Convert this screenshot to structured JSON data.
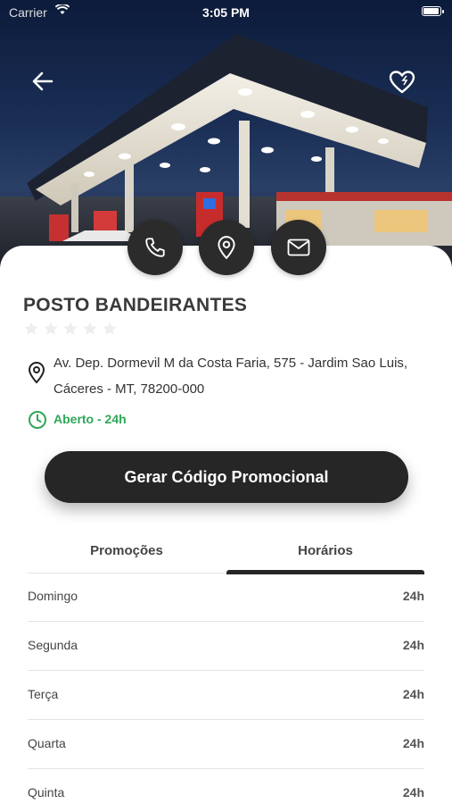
{
  "status_bar": {
    "carrier": "Carrier",
    "time": "3:05 PM",
    "battery_level": 1.0
  },
  "station": {
    "name": "POSTO BANDEIRANTES",
    "rating": 0,
    "rating_max": 5,
    "address": "Av. Dep. Dormevil M da Costa Faria, 575 - Jardim Sao Luis, Cáceres - MT, 78200-000",
    "open_status": "Aberto - 24h"
  },
  "actions": {
    "icons": [
      "phone-icon",
      "map-pin-icon",
      "mail-icon"
    ]
  },
  "promo_button": {
    "label": "Gerar Código Promocional"
  },
  "tabs": [
    {
      "label": "Promoções",
      "active": false
    },
    {
      "label": "Horários",
      "active": true
    }
  ],
  "schedule": [
    {
      "day": "Domingo",
      "hours": "24h"
    },
    {
      "day": "Segunda",
      "hours": "24h"
    },
    {
      "day": "Terça",
      "hours": "24h"
    },
    {
      "day": "Quarta",
      "hours": "24h"
    },
    {
      "day": "Quinta",
      "hours": "24h"
    }
  ],
  "colors": {
    "accent_dark": "#262626",
    "open_green": "#2fa757",
    "text": "#333333"
  }
}
